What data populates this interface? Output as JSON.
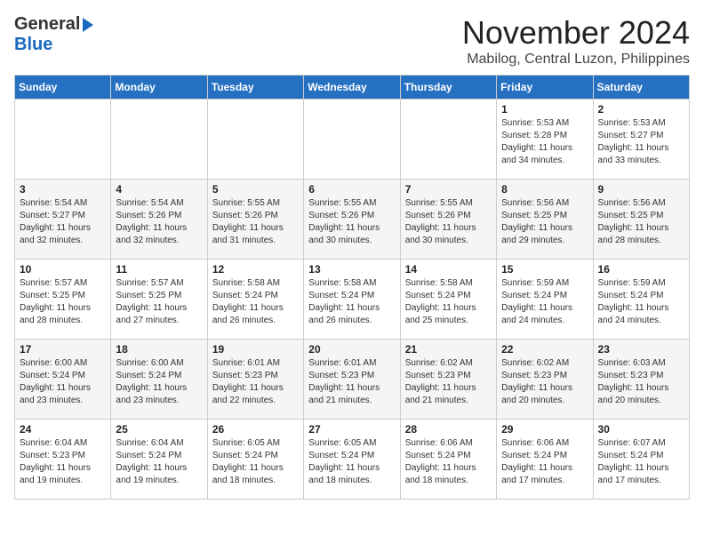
{
  "logo": {
    "line1": "General",
    "line2": "Blue"
  },
  "title": "November 2024",
  "subtitle": "Mabilog, Central Luzon, Philippines",
  "days_of_week": [
    "Sunday",
    "Monday",
    "Tuesday",
    "Wednesday",
    "Thursday",
    "Friday",
    "Saturday"
  ],
  "weeks": [
    [
      {
        "day": "",
        "info": ""
      },
      {
        "day": "",
        "info": ""
      },
      {
        "day": "",
        "info": ""
      },
      {
        "day": "",
        "info": ""
      },
      {
        "day": "",
        "info": ""
      },
      {
        "day": "1",
        "info": "Sunrise: 5:53 AM\nSunset: 5:28 PM\nDaylight: 11 hours\nand 34 minutes."
      },
      {
        "day": "2",
        "info": "Sunrise: 5:53 AM\nSunset: 5:27 PM\nDaylight: 11 hours\nand 33 minutes."
      }
    ],
    [
      {
        "day": "3",
        "info": "Sunrise: 5:54 AM\nSunset: 5:27 PM\nDaylight: 11 hours\nand 32 minutes."
      },
      {
        "day": "4",
        "info": "Sunrise: 5:54 AM\nSunset: 5:26 PM\nDaylight: 11 hours\nand 32 minutes."
      },
      {
        "day": "5",
        "info": "Sunrise: 5:55 AM\nSunset: 5:26 PM\nDaylight: 11 hours\nand 31 minutes."
      },
      {
        "day": "6",
        "info": "Sunrise: 5:55 AM\nSunset: 5:26 PM\nDaylight: 11 hours\nand 30 minutes."
      },
      {
        "day": "7",
        "info": "Sunrise: 5:55 AM\nSunset: 5:26 PM\nDaylight: 11 hours\nand 30 minutes."
      },
      {
        "day": "8",
        "info": "Sunrise: 5:56 AM\nSunset: 5:25 PM\nDaylight: 11 hours\nand 29 minutes."
      },
      {
        "day": "9",
        "info": "Sunrise: 5:56 AM\nSunset: 5:25 PM\nDaylight: 11 hours\nand 28 minutes."
      }
    ],
    [
      {
        "day": "10",
        "info": "Sunrise: 5:57 AM\nSunset: 5:25 PM\nDaylight: 11 hours\nand 28 minutes."
      },
      {
        "day": "11",
        "info": "Sunrise: 5:57 AM\nSunset: 5:25 PM\nDaylight: 11 hours\nand 27 minutes."
      },
      {
        "day": "12",
        "info": "Sunrise: 5:58 AM\nSunset: 5:24 PM\nDaylight: 11 hours\nand 26 minutes."
      },
      {
        "day": "13",
        "info": "Sunrise: 5:58 AM\nSunset: 5:24 PM\nDaylight: 11 hours\nand 26 minutes."
      },
      {
        "day": "14",
        "info": "Sunrise: 5:58 AM\nSunset: 5:24 PM\nDaylight: 11 hours\nand 25 minutes."
      },
      {
        "day": "15",
        "info": "Sunrise: 5:59 AM\nSunset: 5:24 PM\nDaylight: 11 hours\nand 24 minutes."
      },
      {
        "day": "16",
        "info": "Sunrise: 5:59 AM\nSunset: 5:24 PM\nDaylight: 11 hours\nand 24 minutes."
      }
    ],
    [
      {
        "day": "17",
        "info": "Sunrise: 6:00 AM\nSunset: 5:24 PM\nDaylight: 11 hours\nand 23 minutes."
      },
      {
        "day": "18",
        "info": "Sunrise: 6:00 AM\nSunset: 5:24 PM\nDaylight: 11 hours\nand 23 minutes."
      },
      {
        "day": "19",
        "info": "Sunrise: 6:01 AM\nSunset: 5:23 PM\nDaylight: 11 hours\nand 22 minutes."
      },
      {
        "day": "20",
        "info": "Sunrise: 6:01 AM\nSunset: 5:23 PM\nDaylight: 11 hours\nand 21 minutes."
      },
      {
        "day": "21",
        "info": "Sunrise: 6:02 AM\nSunset: 5:23 PM\nDaylight: 11 hours\nand 21 minutes."
      },
      {
        "day": "22",
        "info": "Sunrise: 6:02 AM\nSunset: 5:23 PM\nDaylight: 11 hours\nand 20 minutes."
      },
      {
        "day": "23",
        "info": "Sunrise: 6:03 AM\nSunset: 5:23 PM\nDaylight: 11 hours\nand 20 minutes."
      }
    ],
    [
      {
        "day": "24",
        "info": "Sunrise: 6:04 AM\nSunset: 5:23 PM\nDaylight: 11 hours\nand 19 minutes."
      },
      {
        "day": "25",
        "info": "Sunrise: 6:04 AM\nSunset: 5:24 PM\nDaylight: 11 hours\nand 19 minutes."
      },
      {
        "day": "26",
        "info": "Sunrise: 6:05 AM\nSunset: 5:24 PM\nDaylight: 11 hours\nand 18 minutes."
      },
      {
        "day": "27",
        "info": "Sunrise: 6:05 AM\nSunset: 5:24 PM\nDaylight: 11 hours\nand 18 minutes."
      },
      {
        "day": "28",
        "info": "Sunrise: 6:06 AM\nSunset: 5:24 PM\nDaylight: 11 hours\nand 18 minutes."
      },
      {
        "day": "29",
        "info": "Sunrise: 6:06 AM\nSunset: 5:24 PM\nDaylight: 11 hours\nand 17 minutes."
      },
      {
        "day": "30",
        "info": "Sunrise: 6:07 AM\nSunset: 5:24 PM\nDaylight: 11 hours\nand 17 minutes."
      }
    ]
  ]
}
